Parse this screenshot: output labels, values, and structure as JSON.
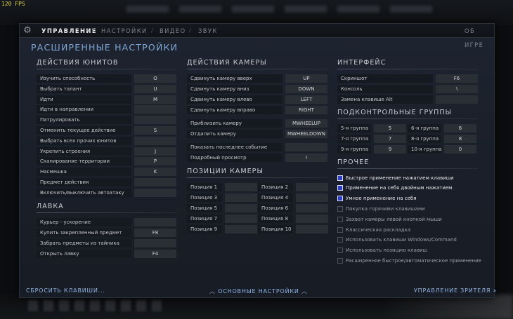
{
  "fps": "120 FPS",
  "nav": {
    "tabs": [
      {
        "label": "УПРАВЛЕНИЕ"
      },
      {
        "label": "НАСТРОЙКИ"
      },
      {
        "label": "ВИДЕО"
      },
      {
        "label": "ЗВУК"
      }
    ],
    "sep": "/",
    "about": "ОБ ИГРЕ"
  },
  "title": "РАСШИРЕННЫЕ НАСТРОЙКИ",
  "units": {
    "title": "ДЕЙСТВИЯ ЮНИТОВ",
    "rows": [
      {
        "label": "Изучить способность",
        "key": "O"
      },
      {
        "label": "Выбрать талант",
        "key": "U"
      },
      {
        "label": "Идти",
        "key": "M"
      },
      {
        "label": "Идти в направлении",
        "key": ""
      },
      {
        "label": "Патрулировать",
        "key": ""
      },
      {
        "label": "Отменить текущее действие",
        "key": "S"
      },
      {
        "label": "Выбрать всех прочих юнитов",
        "key": ""
      },
      {
        "label": "Укрепить строения",
        "key": "J"
      },
      {
        "label": "Сканирование территории",
        "key": "P"
      },
      {
        "label": "Насмешка",
        "key": "K"
      },
      {
        "label": "Предмет действия",
        "key": ""
      },
      {
        "label": "Включить/выключить автоатаку",
        "key": ""
      }
    ]
  },
  "shop": {
    "title": "ЛАВКА",
    "rows": [
      {
        "label": "Курьер - ускорение",
        "key": ""
      },
      {
        "label": "Купить закрепленный предмет",
        "key": "F8"
      },
      {
        "label": "Забрать предметы из тайника",
        "key": ""
      },
      {
        "label": "Открыть лавку",
        "key": "F4"
      }
    ]
  },
  "camera": {
    "title": "ДЕЙСТВИЯ КАМЕРЫ",
    "rows": [
      {
        "label": "Сдвинуть камеру вверх",
        "key": "UP"
      },
      {
        "label": "Сдвинуть камеру вниз",
        "key": "DOWN"
      },
      {
        "label": "Сдвинуть камеру влево",
        "key": "LEFT"
      },
      {
        "label": "Сдвинуть камеру вправо",
        "key": "RIGHT"
      },
      {
        "label": "Приблизить камеру",
        "key": "MWHEELUP"
      },
      {
        "label": "Отдалить камеру",
        "key": "MWHEELDOWN"
      },
      {
        "label": "Показать последнее событие",
        "key": ""
      },
      {
        "label": "Подробный просмотр",
        "key": "I"
      }
    ]
  },
  "positions": {
    "title": "ПОЗИЦИИ КАМЕРЫ",
    "rows": [
      {
        "label": "Позиция 1",
        "key": ""
      },
      {
        "label": "Позиция 2",
        "key": ""
      },
      {
        "label": "Позиция 3",
        "key": ""
      },
      {
        "label": "Позиция 4",
        "key": ""
      },
      {
        "label": "Позиция 5",
        "key": ""
      },
      {
        "label": "Позиция 6",
        "key": ""
      },
      {
        "label": "Позиция 7",
        "key": ""
      },
      {
        "label": "Позиция 8",
        "key": ""
      },
      {
        "label": "Позиция 9",
        "key": ""
      },
      {
        "label": "Позиция 10",
        "key": ""
      }
    ]
  },
  "interface": {
    "title": "ИНТЕРФЕЙС",
    "rows": [
      {
        "label": "Скриншот",
        "key": "F6"
      },
      {
        "label": "Консоль",
        "key": "\\"
      },
      {
        "label": "Замена клавише Alt",
        "key": ""
      }
    ]
  },
  "groups": {
    "title": "ПОДКОНТРОЛЬНЫЕ ГРУППЫ",
    "rows": [
      {
        "label": "5-я группа",
        "key": "5"
      },
      {
        "label": "6-я группа",
        "key": "6"
      },
      {
        "label": "7-я группа",
        "key": "7"
      },
      {
        "label": "8-я группа",
        "key": "8"
      },
      {
        "label": "9-я группа",
        "key": "9"
      },
      {
        "label": "10-я группа",
        "key": "0"
      }
    ]
  },
  "other": {
    "title": "ПРОЧЕЕ",
    "options": [
      {
        "label": "Быстрое применение нажатием клавиши",
        "checked": true
      },
      {
        "label": "Применение на себя двойным нажатием",
        "checked": true
      },
      {
        "label": "Умное применение на себя",
        "checked": true
      },
      {
        "label": "Покупка горячими клавишами",
        "checked": false
      },
      {
        "label": "Захват камеры левой кнопкой мыши",
        "checked": false
      },
      {
        "label": "Классическая раскладка",
        "checked": false
      },
      {
        "label": "Использовать клавиши Windows/Command",
        "checked": false
      },
      {
        "label": "Использовать позицию клавиш",
        "checked": false
      },
      {
        "label": "Расширенное быстрое/автоматическое применение",
        "checked": false
      }
    ]
  },
  "footer": {
    "reset": "СБРОСИТЬ КЛАВИШИ...",
    "basic": "ОСНОВНЫЕ НАСТРОЙКИ",
    "basic_arrow": "︿",
    "spectator": "УПРАВЛЕНИЕ ЗРИТЕЛЯ",
    "spectator_arrow": "»"
  },
  "colors": {
    "accent": "#7fa7d6",
    "checkbox_on": "#2d3ec9"
  }
}
